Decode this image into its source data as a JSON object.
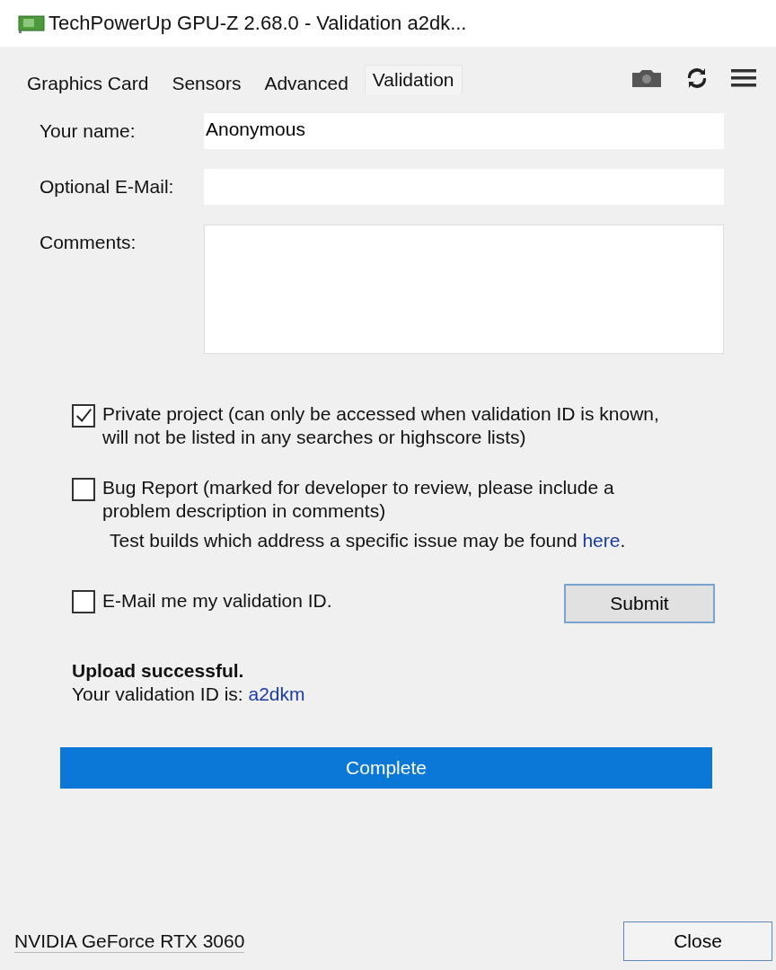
{
  "window": {
    "title": "TechPowerUp GPU-Z 2.68.0 - Validation a2dk..."
  },
  "tabs": [
    {
      "label": "Graphics Card",
      "selected": false
    },
    {
      "label": "Sensors",
      "selected": false
    },
    {
      "label": "Advanced",
      "selected": false
    },
    {
      "label": "Validation",
      "selected": true
    }
  ],
  "fields": [
    {
      "label": "Your name:",
      "kind": "line",
      "value": "Anonymous"
    },
    {
      "label": "Optional E-Mail:",
      "kind": "line"
    },
    {
      "label": "Comments:",
      "kind": "area"
    }
  ],
  "options": [
    {
      "label": "Private project (can only be accessed when validation ID is known, will not be listed in any searches or highscore lists)",
      "checked": true
    },
    {
      "label": "Bug Report (marked for developer to review, please include a problem description in comments)",
      "checked": false
    }
  ],
  "note": {
    "text": "Test builds which address a specific issue may be found ",
    "link": "here",
    "after": "."
  },
  "email_option": {
    "label": "E-Mail me my validation ID.",
    "checked": false
  },
  "submit_button": "Submit",
  "result": {
    "title": "Upload successful.",
    "text": "Your validation ID is: ",
    "link": "a2dkm"
  },
  "progress": {
    "label": "Complete"
  },
  "status_bar": {
    "device": "NVIDIA GeForce RTX 3060",
    "close_button": "Close"
  }
}
